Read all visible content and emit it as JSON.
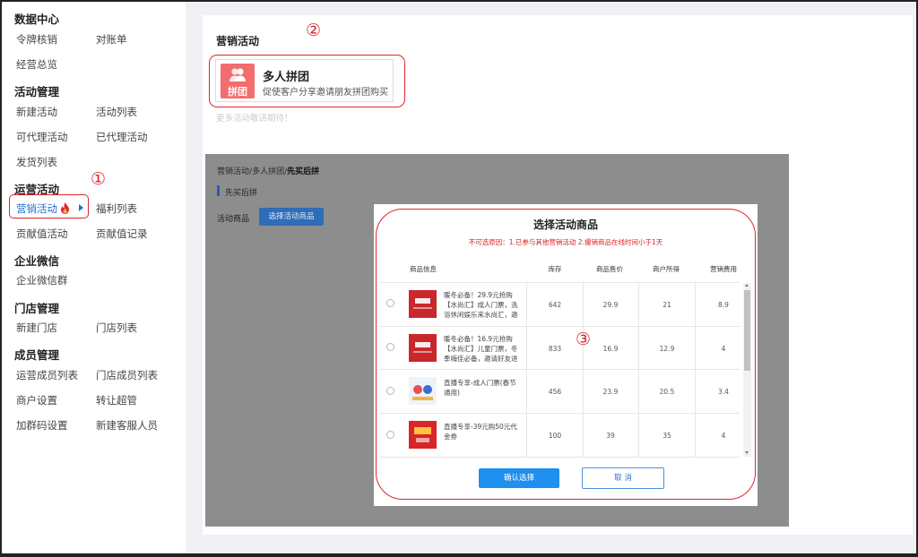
{
  "sidebar": {
    "sections": [
      {
        "title": "数据中心",
        "items": [
          "令牌核销",
          "对账单",
          "经营总览"
        ]
      },
      {
        "title": "活动管理",
        "items": [
          "新建活动",
          "活动列表",
          "可代理活动",
          "已代理活动",
          "发货列表"
        ]
      },
      {
        "title": "运营活动",
        "items": [
          "营销活动",
          "福利列表",
          "贡献值活动",
          "贡献值记录"
        ]
      },
      {
        "title": "企业微信",
        "items": [
          "企业微信群"
        ]
      },
      {
        "title": "门店管理",
        "items": [
          "新建门店",
          "门店列表"
        ]
      },
      {
        "title": "成员管理",
        "items": [
          "运营成员列表",
          "门店成员列表",
          "商户设置",
          "转让超管",
          "加群码设置",
          "新建客服人员"
        ]
      }
    ],
    "active_item": "营销活动",
    "accent_color": "#1f6fd1"
  },
  "markers": [
    "①",
    "②",
    "③"
  ],
  "main": {
    "title": "营销活动",
    "activity": {
      "icon": "people-icon",
      "icon_label": "拼团",
      "name": "多人拼团",
      "desc": "促使客户分享邀请朋友拼团购买"
    },
    "more_text": "更多活动敬请期待！"
  },
  "background_page": {
    "breadcrumb": [
      "营销活动",
      "多人拼团",
      "先买后拼"
    ],
    "subheading": "先买后拼",
    "field_label": "活动商品",
    "select_button": "选择活动商品"
  },
  "modal": {
    "title": "选择活动商品",
    "note": "不可选原因：1.已参与其他营销活动 2.撮销商品在线时间小于1天",
    "columns": [
      "商品信息",
      "库存",
      "商品售价",
      "商户所得",
      "营销费用"
    ],
    "rows": [
      {
        "thumb_line1": "成人门票",
        "name": "暖冬必备！29.9元抢购【水尚汇】成人门票，洗浴休闲娱乐来水尚汇，邀",
        "stock": "642",
        "price": "29.9",
        "merchant": "21",
        "fee": "8.9"
      },
      {
        "thumb_line1": "儿童门票",
        "name": "暖冬必备！16.9元抢购【水尚汇】儿童门票，冬季嗨佳必备，邀请好友进",
        "stock": "833",
        "price": "16.9",
        "merchant": "12.9",
        "fee": "4"
      },
      {
        "thumb_line1": "",
        "name": "直播专享-成人门票(春节通用)",
        "stock": "456",
        "price": "23.9",
        "merchant": "20.5",
        "fee": "3.4"
      },
      {
        "thumb_line1": "",
        "name": "直播专享-39元购50元代金券",
        "stock": "100",
        "price": "39",
        "merchant": "35",
        "fee": "4"
      }
    ],
    "confirm_label": "确认选择",
    "cancel_label": "取 消",
    "highlight_color": "#e0252f"
  }
}
